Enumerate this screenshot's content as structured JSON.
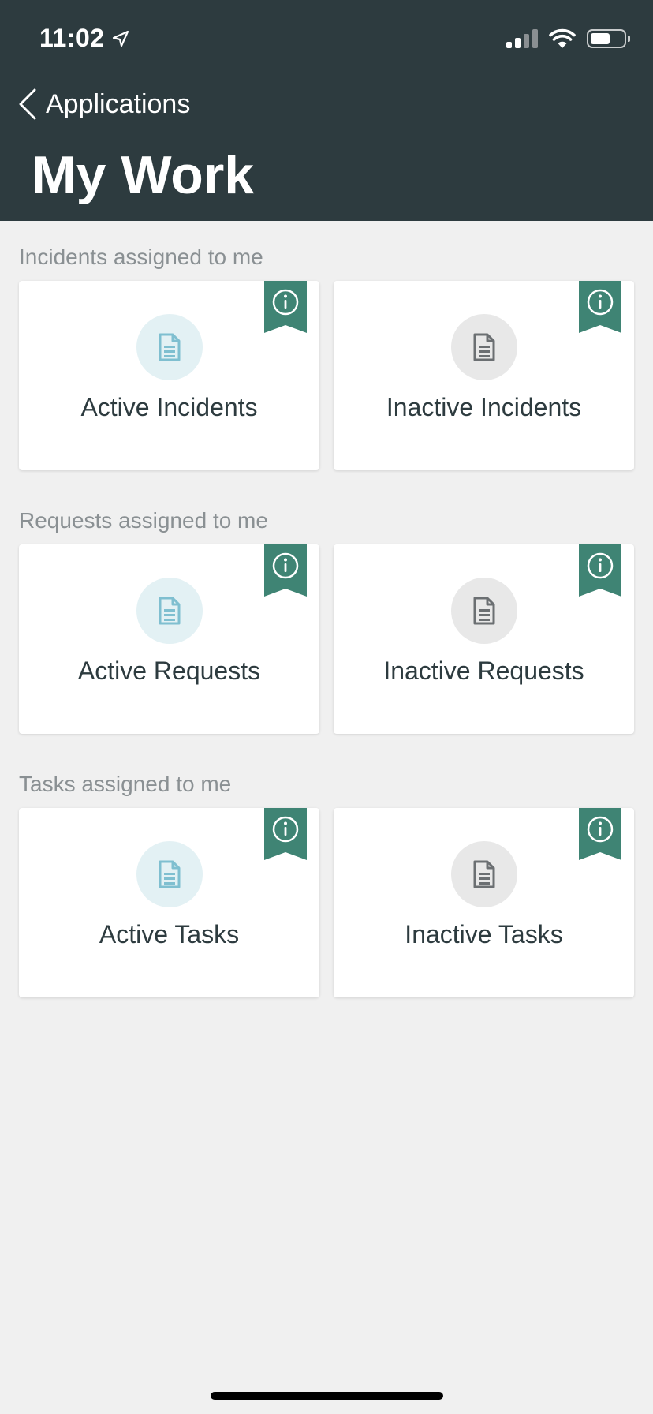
{
  "status_bar": {
    "time": "11:02"
  },
  "nav": {
    "back_label": "Applications",
    "title": "My Work"
  },
  "sections": [
    {
      "label": "Incidents assigned to me",
      "cards": [
        {
          "label": "Active Incidents",
          "state": "active"
        },
        {
          "label": "Inactive Incidents",
          "state": "inactive"
        }
      ]
    },
    {
      "label": "Requests assigned to me",
      "cards": [
        {
          "label": "Active Requests",
          "state": "active"
        },
        {
          "label": "Inactive Requests",
          "state": "inactive"
        }
      ]
    },
    {
      "label": "Tasks assigned to me",
      "cards": [
        {
          "label": "Active Tasks",
          "state": "active"
        },
        {
          "label": "Inactive Tasks",
          "state": "inactive"
        }
      ]
    }
  ],
  "colors": {
    "header_bg": "#2d3b3f",
    "ribbon": "#3f8474",
    "active_icon": "#7fbfd0",
    "inactive_icon": "#6b6f72"
  }
}
